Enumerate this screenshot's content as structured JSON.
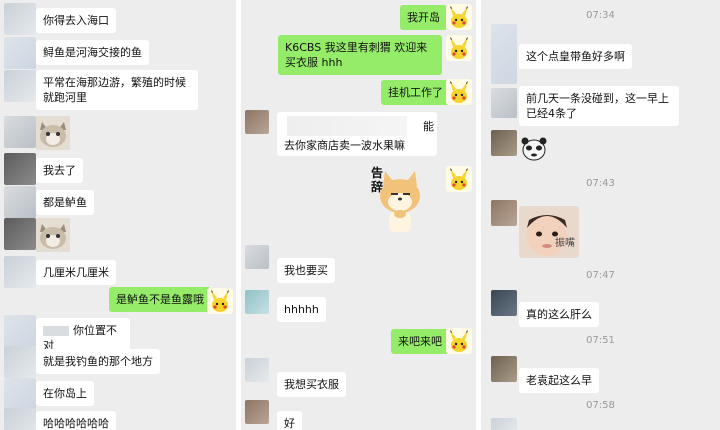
{
  "panel1": {
    "messages": [
      "你得去入海口",
      "鲟鱼是河海交接的鱼",
      "平常在海那边游，繁殖的时候就跑河里",
      "我去了",
      "都是鲈鱼",
      "几厘米几厘米",
      "是鲈鱼不是鱼露哦",
      "你位置不对",
      "就是我钓鱼的那个地方",
      "在你岛上",
      "哈哈哈哈哈哈"
    ]
  },
  "panel2": {
    "messages": [
      "我开岛",
      "K6CBS 我这里有刺猬 欢迎来买衣服 hhh",
      "挂机工作了",
      "能",
      "去你家商店卖一波水果嘛",
      "我也要买",
      "hhhhh",
      "来吧来吧",
      "我想买衣服",
      "好"
    ],
    "sticker_text": "告辞"
  },
  "panel3": {
    "times": [
      "07:34",
      "07:43",
      "07:47",
      "07:51",
      "07:58"
    ],
    "messages": [
      "这个点皇带鱼好多啊",
      "前几天一条没碰到，这一早上已经4条了",
      "真的这么肝么",
      "老袁起这么早"
    ],
    "photo_caption": "振嘴"
  }
}
